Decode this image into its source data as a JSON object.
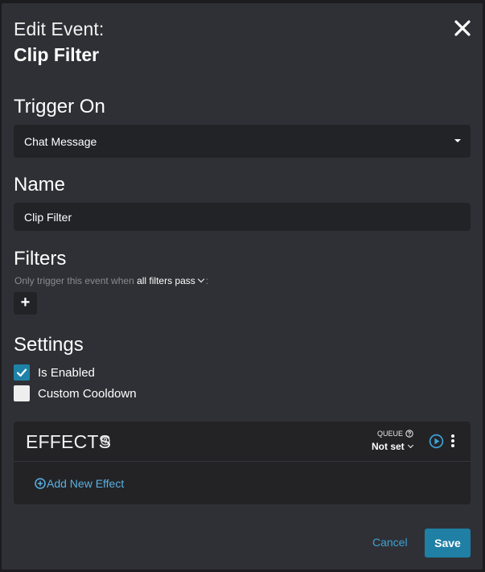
{
  "dialog": {
    "title_prefix": "Edit Event:",
    "title_name": "Clip Filter"
  },
  "trigger": {
    "label": "Trigger On",
    "selected": "Chat Message"
  },
  "name": {
    "label": "Name",
    "value": "Clip Filter"
  },
  "filters": {
    "label": "Filters",
    "hint_prefix": "Only trigger this event when",
    "mode": "all filters pass",
    "hint_suffix": ":",
    "add_label": "+"
  },
  "settings": {
    "label": "Settings",
    "options": [
      {
        "label": "Is Enabled",
        "checked": true
      },
      {
        "label": "Custom Cooldown",
        "checked": false
      }
    ]
  },
  "effects": {
    "title": "EFFECTS",
    "queue_label": "QUEUE",
    "queue_value": "Not set",
    "add_label": "Add New Effect"
  },
  "footer": {
    "cancel_label": "Cancel",
    "save_label": "Save"
  },
  "colors": {
    "background": "#2f3035",
    "field": "#222327",
    "accent": "#1f7fa5",
    "link": "#3da3d8"
  }
}
